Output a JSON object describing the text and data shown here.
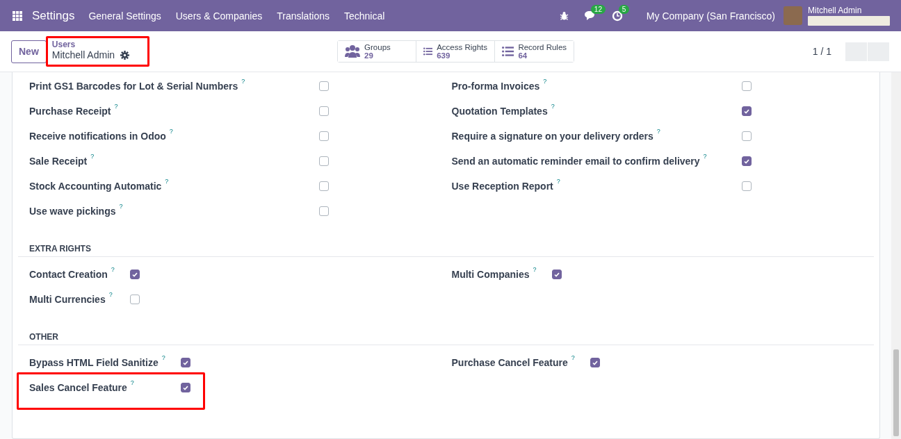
{
  "navbar": {
    "app": "Settings",
    "menu": [
      "General Settings",
      "Users & Companies",
      "Translations",
      "Technical"
    ],
    "messages_badge": "12",
    "activities_badge": "5",
    "company": "My Company (San Francisco)",
    "user": "Mitchell Admin"
  },
  "control_panel": {
    "new_button": "New",
    "breadcrumb": {
      "parent": "Users",
      "current": "Mitchell Admin",
      "highlighted": true
    },
    "stat_buttons": [
      {
        "kind": "groups",
        "label": "Groups",
        "value": "29"
      },
      {
        "kind": "list",
        "label": "Access Rights",
        "value": "639"
      },
      {
        "kind": "list",
        "label": "Record Rules",
        "value": "64"
      }
    ],
    "pager": "1 / 1"
  },
  "sections": [
    {
      "kind": "fixed",
      "columns": [
        [
          {
            "label": "Print GS1 Barcodes for Lot & Serial Numbers",
            "help": "?",
            "checked": false,
            "highlighted": false
          },
          {
            "label": "Purchase Receipt",
            "help": "?",
            "checked": false,
            "highlighted": false
          },
          {
            "label": "Receive notifications in Odoo",
            "help": "?",
            "checked": false,
            "highlighted": false
          },
          {
            "label": "Sale Receipt",
            "help": "?",
            "checked": false,
            "highlighted": false
          },
          {
            "label": "Stock Accounting Automatic",
            "help": "?",
            "checked": false,
            "highlighted": false
          },
          {
            "label": "Use wave pickings",
            "help": "?",
            "checked": false,
            "highlighted": false
          }
        ],
        [
          {
            "label": "Pro-forma Invoices",
            "help": "?",
            "checked": false,
            "highlighted": false
          },
          {
            "label": "Quotation Templates",
            "help": "?",
            "checked": true,
            "highlighted": false
          },
          {
            "label": "Require a signature on your delivery orders",
            "help": "?",
            "checked": false,
            "highlighted": false
          },
          {
            "label": "Send an automatic reminder email to confirm delivery",
            "help": "?",
            "checked": true,
            "highlighted": false
          },
          {
            "label": "Use Reception Report",
            "help": "?",
            "checked": false,
            "highlighted": false
          }
        ]
      ]
    },
    {
      "kind": "auto",
      "title": "EXTRA RIGHTS",
      "columns": [
        [
          {
            "label": "Contact Creation",
            "help": "?",
            "checked": true,
            "highlighted": false
          },
          {
            "label": "Multi Currencies",
            "help": "?",
            "checked": false,
            "highlighted": false
          }
        ],
        [
          {
            "label": "Multi Companies",
            "help": "?",
            "checked": true,
            "highlighted": false
          }
        ]
      ]
    },
    {
      "kind": "auto",
      "title": "OTHER",
      "columns": [
        [
          {
            "label": "Bypass HTML Field Sanitize",
            "help": "?",
            "checked": true,
            "highlighted": false
          },
          {
            "label": "Sales Cancel Feature",
            "help": "?",
            "checked": true,
            "highlighted": true
          }
        ],
        [
          {
            "label": "Purchase Cancel Feature",
            "help": "?",
            "checked": true,
            "highlighted": false
          }
        ]
      ]
    }
  ]
}
